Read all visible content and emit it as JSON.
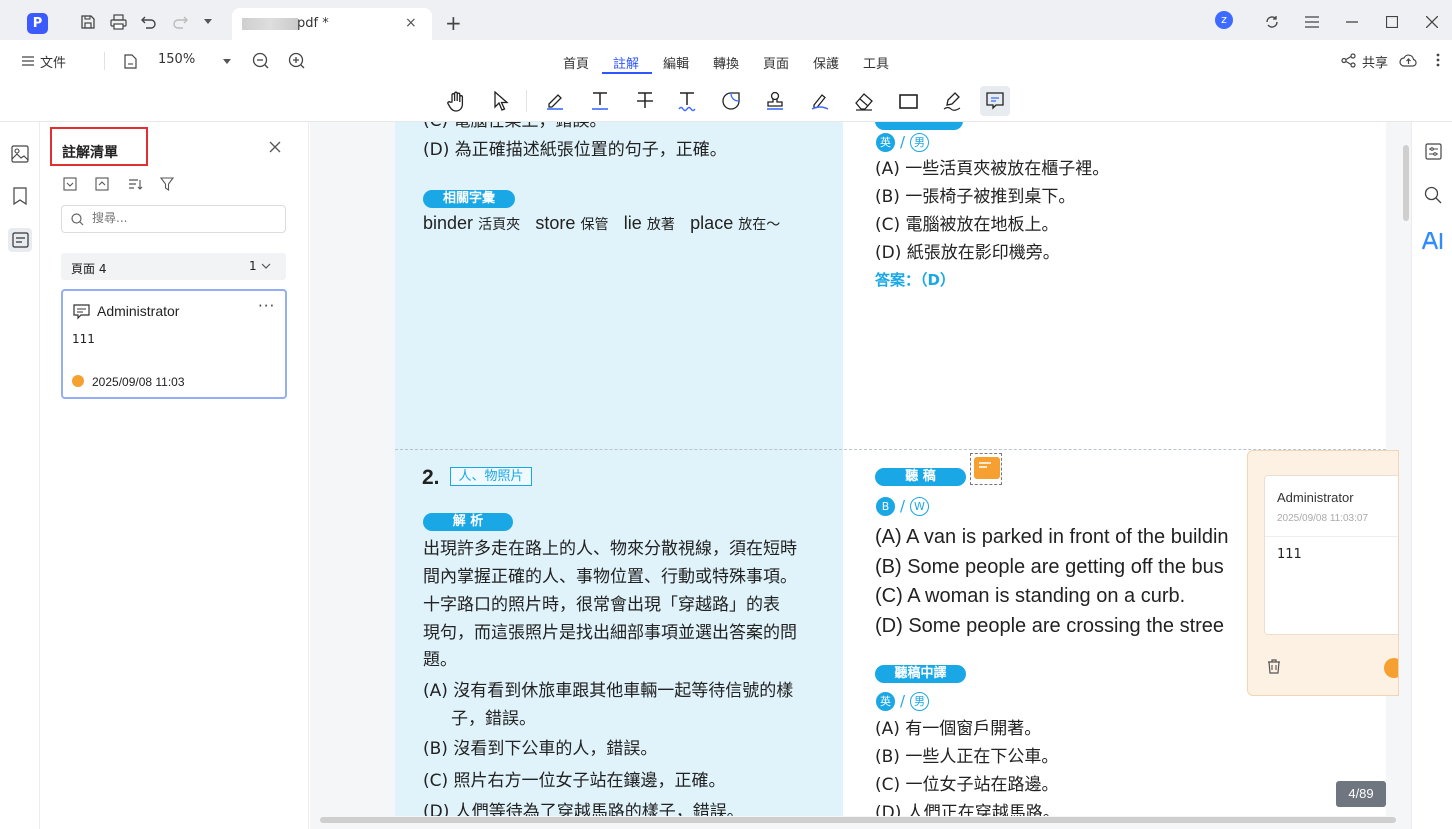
{
  "titlebar": {
    "app_logo": "P",
    "tab_title": "pdf *",
    "tab_close": "×",
    "new_tab": "+",
    "user_initial": "z"
  },
  "menubar": {
    "file_label": "文件",
    "zoom_value": "150%",
    "tabs": [
      "首頁",
      "註解",
      "編輯",
      "轉換",
      "頁面",
      "保護",
      "工具"
    ],
    "active_tab": "註解",
    "share_label": "共享"
  },
  "panel": {
    "title": "註解清單",
    "search_placeholder": "搜尋...",
    "page_group_label": "頁面 4",
    "page_group_count": "1",
    "card": {
      "author": "Administrator",
      "more": "···",
      "body": "111",
      "date": "2025/09/08 11:03"
    }
  },
  "document": {
    "left_top": {
      "line_cut": "(C) 電腦在桌上，錯誤。",
      "line_d": "(D) 為正確描述紙張位置的句子，正確。",
      "vocab_title": "相關字彙",
      "vocab": [
        {
          "en": "binder",
          "zh": "活頁夾"
        },
        {
          "en": "store",
          "zh": "保管"
        },
        {
          "en": "lie",
          "zh": "放著"
        },
        {
          "en": "place",
          "zh": "放在～"
        }
      ]
    },
    "right_top": {
      "badge_fill": "英",
      "badge_out": "男",
      "options": [
        "(A) 一些活頁夾被放在櫃子裡。",
        "(B) 一張椅子被推到桌下。",
        "(C) 電腦被放在地板上。",
        "(D) 紙張放在影印機旁。"
      ],
      "answer": "答案：（D）"
    },
    "left_bottom": {
      "number": "2.",
      "category_tag": "人、物照片",
      "analysis_title": "解 析",
      "analysis_lines": [
        "出現許多走在路上的人、物來分散視線，須在短時",
        "間內掌握正確的人、事物位置、行動或特殊事項。",
        "十字路口的照片時，很常會出現「穿越路」的表",
        "現句，而這張照片是找出細部事項並選出答案的問",
        "題。"
      ],
      "options": [
        "(A) 沒有看到休旅車跟其他車輛一起等待信號的樣",
        "子，錯誤。",
        "(B) 沒看到下公車的人，錯誤。",
        "(C) 照片右方一位女子站在鑲邊，正確。",
        "(D) 人們等待為了穿越馬路的樣子，錯誤。"
      ]
    },
    "right_bottom": {
      "script_title": "聽 稿",
      "badge_fill": "B",
      "badge_out": "W",
      "script_lines": [
        "(A) A van is parked in front of the buildin",
        "(B) Some people are getting off the bus",
        "(C) A woman is standing on a curb.",
        "(D) Some people are crossing the stree"
      ],
      "translation_title": "聽稿中譯",
      "badge2_fill": "英",
      "badge2_out": "男",
      "translation_lines": [
        "(A) 有一個窗戶開著。",
        "(B) 一些人正在下公車。",
        "(C) 一位女子站在路邊。",
        "(D) 人們正在穿越馬路。"
      ]
    }
  },
  "popup": {
    "author": "Administrator",
    "date": "2025/09/08 11:03:07",
    "body": "111"
  },
  "page_indicator": "4/89",
  "colors": {
    "accent": "#2f55ff",
    "highlight_bg": "#e0f3fb",
    "label_blue": "#1aa7e6",
    "note_orange": "#f5a031",
    "panel_title_border": "#e03030"
  }
}
